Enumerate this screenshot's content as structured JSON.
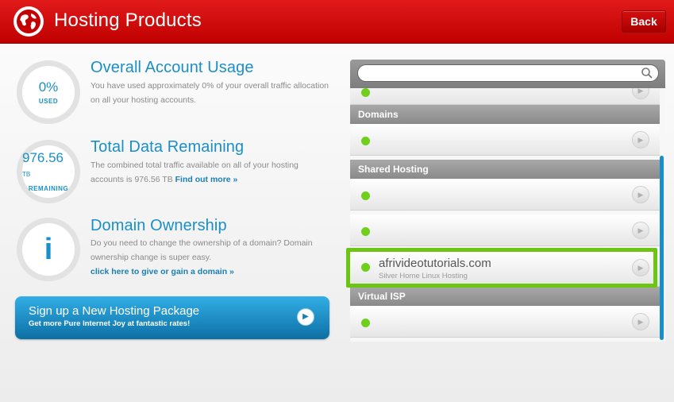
{
  "header": {
    "title": "Hosting Products",
    "back_label": "Back"
  },
  "account_usage": {
    "ring_value": "0%",
    "ring_label": "USED",
    "title": "Overall Account Usage",
    "description": "You have used approximately 0% of your overall traffic allocation on all your hosting accounts."
  },
  "data_remaining": {
    "ring_value": "976.56",
    "ring_unit": "TB",
    "ring_label": "REMAINING",
    "title": "Total Data Remaining",
    "description": "The combined total traffic available on all of your hosting accounts is",
    "value": "976.56 TB",
    "link": "Find out more »"
  },
  "domain_ownership": {
    "title": "Domain Ownership",
    "description": "Do you need to change the ownership of a domain? Domain ownership change is super easy.",
    "link": "click here to give or gain a domain »"
  },
  "signup": {
    "title": "Sign up a New Hosting Package",
    "subtitle": "Get more Pure Internet Joy at fantastic rates!"
  },
  "search": {
    "placeholder": ""
  },
  "sections": [
    {
      "label": "Domains"
    },
    {
      "label": "Shared Hosting"
    },
    {
      "label": "Virtual ISP"
    }
  ],
  "selected_item": {
    "title": "afrivideotutorials.com",
    "subtitle": "Silver Home Linux Hosting"
  },
  "colors": {
    "header_red": "#d10f0f",
    "accent_blue": "#1a8fc7",
    "status_green": "#6fcf1a",
    "highlight_green": "#6cc413"
  }
}
